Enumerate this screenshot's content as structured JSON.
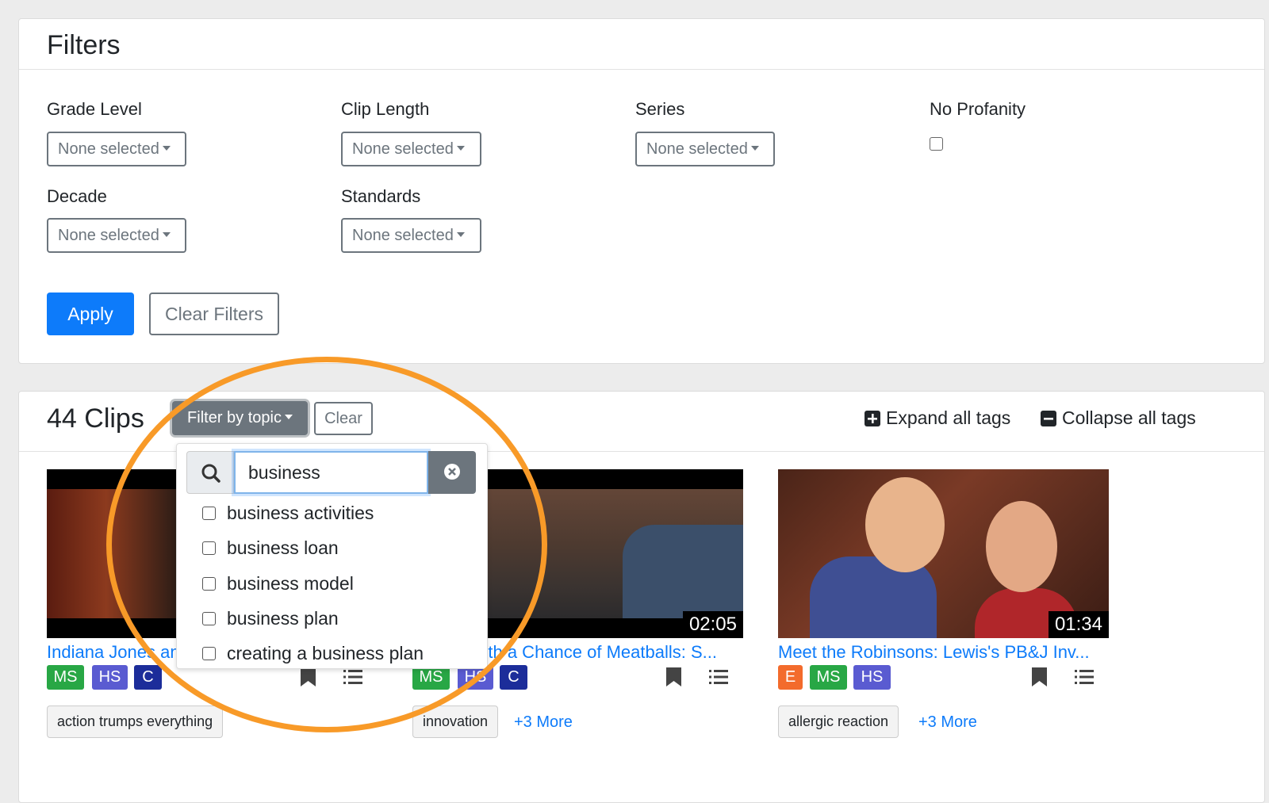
{
  "filters": {
    "title": "Filters",
    "grade_level": {
      "label": "Grade Level",
      "value": "None selected"
    },
    "clip_length": {
      "label": "Clip Length",
      "value": "None selected"
    },
    "series": {
      "label": "Series",
      "value": "None selected"
    },
    "no_profanity": {
      "label": "No Profanity",
      "checked": false
    },
    "decade": {
      "label": "Decade",
      "value": "None selected"
    },
    "standards": {
      "label": "Standards",
      "value": "None selected"
    },
    "apply_label": "Apply",
    "clear_label": "Clear Filters"
  },
  "clips": {
    "title": "44 Clips",
    "filter_topic_label": "Filter by topic",
    "clear_label": "Clear",
    "expand_label": "Expand all tags",
    "collapse_label": "Collapse all tags",
    "items": [
      {
        "title": "Indiana Jones and the Last Crusade: ...",
        "duration": "",
        "badges": [
          {
            "text": "MS",
            "color": "#28a745"
          },
          {
            "text": "HS",
            "color": "#5a5bd1"
          },
          {
            "text": "C",
            "color": "#1c2d9a"
          }
        ],
        "tag": "action trumps everything",
        "more": ""
      },
      {
        "title": "Cloudy with a Chance of Meatballs: S...",
        "duration": "02:05",
        "badges": [
          {
            "text": "MS",
            "color": "#28a745"
          },
          {
            "text": "HS",
            "color": "#5a5bd1"
          },
          {
            "text": "C",
            "color": "#1c2d9a"
          }
        ],
        "tag": "innovation",
        "more": "+3 More"
      },
      {
        "title": "Meet the Robinsons: Lewis's PB&J Inv...",
        "duration": "01:34",
        "badges": [
          {
            "text": "E",
            "color": "#f36b2c"
          },
          {
            "text": "MS",
            "color": "#28a745"
          },
          {
            "text": "HS",
            "color": "#5a5bd1"
          }
        ],
        "tag": "allergic reaction",
        "more": "+3 More"
      }
    ]
  },
  "topic_dropdown": {
    "search_value": "business",
    "options": [
      "business activities",
      "business loan",
      "business model",
      "business plan",
      "creating a business plan"
    ]
  },
  "colors": {
    "primary": "#0d7bfa",
    "secondary": "#6c757d",
    "highlight": "#f89a28"
  }
}
